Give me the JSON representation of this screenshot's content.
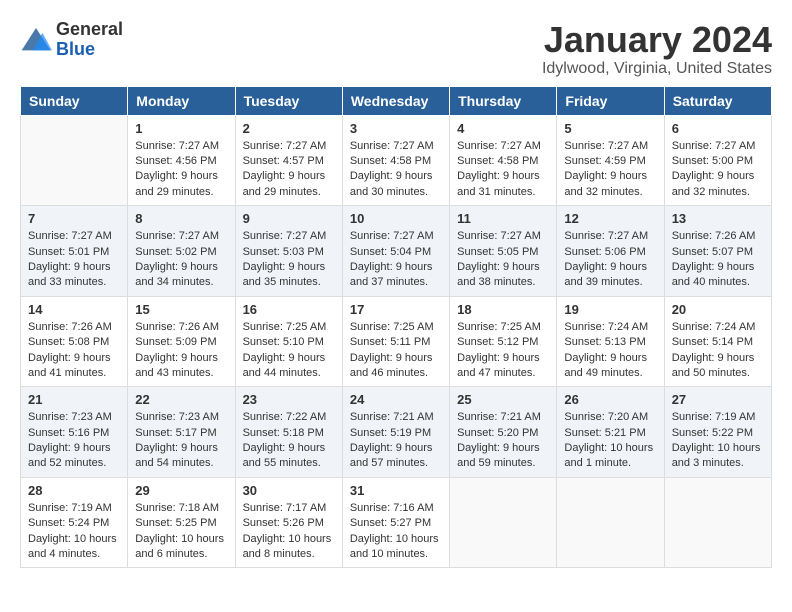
{
  "logo": {
    "general": "General",
    "blue": "Blue"
  },
  "header": {
    "title": "January 2024",
    "subtitle": "Idylwood, Virginia, United States"
  },
  "days_of_week": [
    "Sunday",
    "Monday",
    "Tuesday",
    "Wednesday",
    "Thursday",
    "Friday",
    "Saturday"
  ],
  "weeks": [
    [
      {
        "day": "",
        "content": ""
      },
      {
        "day": "1",
        "content": "Sunrise: 7:27 AM\nSunset: 4:56 PM\nDaylight: 9 hours\nand 29 minutes."
      },
      {
        "day": "2",
        "content": "Sunrise: 7:27 AM\nSunset: 4:57 PM\nDaylight: 9 hours\nand 29 minutes."
      },
      {
        "day": "3",
        "content": "Sunrise: 7:27 AM\nSunset: 4:58 PM\nDaylight: 9 hours\nand 30 minutes."
      },
      {
        "day": "4",
        "content": "Sunrise: 7:27 AM\nSunset: 4:58 PM\nDaylight: 9 hours\nand 31 minutes."
      },
      {
        "day": "5",
        "content": "Sunrise: 7:27 AM\nSunset: 4:59 PM\nDaylight: 9 hours\nand 32 minutes."
      },
      {
        "day": "6",
        "content": "Sunrise: 7:27 AM\nSunset: 5:00 PM\nDaylight: 9 hours\nand 32 minutes."
      }
    ],
    [
      {
        "day": "7",
        "content": "Sunrise: 7:27 AM\nSunset: 5:01 PM\nDaylight: 9 hours\nand 33 minutes."
      },
      {
        "day": "8",
        "content": "Sunrise: 7:27 AM\nSunset: 5:02 PM\nDaylight: 9 hours\nand 34 minutes."
      },
      {
        "day": "9",
        "content": "Sunrise: 7:27 AM\nSunset: 5:03 PM\nDaylight: 9 hours\nand 35 minutes."
      },
      {
        "day": "10",
        "content": "Sunrise: 7:27 AM\nSunset: 5:04 PM\nDaylight: 9 hours\nand 37 minutes."
      },
      {
        "day": "11",
        "content": "Sunrise: 7:27 AM\nSunset: 5:05 PM\nDaylight: 9 hours\nand 38 minutes."
      },
      {
        "day": "12",
        "content": "Sunrise: 7:27 AM\nSunset: 5:06 PM\nDaylight: 9 hours\nand 39 minutes."
      },
      {
        "day": "13",
        "content": "Sunrise: 7:26 AM\nSunset: 5:07 PM\nDaylight: 9 hours\nand 40 minutes."
      }
    ],
    [
      {
        "day": "14",
        "content": "Sunrise: 7:26 AM\nSunset: 5:08 PM\nDaylight: 9 hours\nand 41 minutes."
      },
      {
        "day": "15",
        "content": "Sunrise: 7:26 AM\nSunset: 5:09 PM\nDaylight: 9 hours\nand 43 minutes."
      },
      {
        "day": "16",
        "content": "Sunrise: 7:25 AM\nSunset: 5:10 PM\nDaylight: 9 hours\nand 44 minutes."
      },
      {
        "day": "17",
        "content": "Sunrise: 7:25 AM\nSunset: 5:11 PM\nDaylight: 9 hours\nand 46 minutes."
      },
      {
        "day": "18",
        "content": "Sunrise: 7:25 AM\nSunset: 5:12 PM\nDaylight: 9 hours\nand 47 minutes."
      },
      {
        "day": "19",
        "content": "Sunrise: 7:24 AM\nSunset: 5:13 PM\nDaylight: 9 hours\nand 49 minutes."
      },
      {
        "day": "20",
        "content": "Sunrise: 7:24 AM\nSunset: 5:14 PM\nDaylight: 9 hours\nand 50 minutes."
      }
    ],
    [
      {
        "day": "21",
        "content": "Sunrise: 7:23 AM\nSunset: 5:16 PM\nDaylight: 9 hours\nand 52 minutes."
      },
      {
        "day": "22",
        "content": "Sunrise: 7:23 AM\nSunset: 5:17 PM\nDaylight: 9 hours\nand 54 minutes."
      },
      {
        "day": "23",
        "content": "Sunrise: 7:22 AM\nSunset: 5:18 PM\nDaylight: 9 hours\nand 55 minutes."
      },
      {
        "day": "24",
        "content": "Sunrise: 7:21 AM\nSunset: 5:19 PM\nDaylight: 9 hours\nand 57 minutes."
      },
      {
        "day": "25",
        "content": "Sunrise: 7:21 AM\nSunset: 5:20 PM\nDaylight: 9 hours\nand 59 minutes."
      },
      {
        "day": "26",
        "content": "Sunrise: 7:20 AM\nSunset: 5:21 PM\nDaylight: 10 hours\nand 1 minute."
      },
      {
        "day": "27",
        "content": "Sunrise: 7:19 AM\nSunset: 5:22 PM\nDaylight: 10 hours\nand 3 minutes."
      }
    ],
    [
      {
        "day": "28",
        "content": "Sunrise: 7:19 AM\nSunset: 5:24 PM\nDaylight: 10 hours\nand 4 minutes."
      },
      {
        "day": "29",
        "content": "Sunrise: 7:18 AM\nSunset: 5:25 PM\nDaylight: 10 hours\nand 6 minutes."
      },
      {
        "day": "30",
        "content": "Sunrise: 7:17 AM\nSunset: 5:26 PM\nDaylight: 10 hours\nand 8 minutes."
      },
      {
        "day": "31",
        "content": "Sunrise: 7:16 AM\nSunset: 5:27 PM\nDaylight: 10 hours\nand 10 minutes."
      },
      {
        "day": "",
        "content": ""
      },
      {
        "day": "",
        "content": ""
      },
      {
        "day": "",
        "content": ""
      }
    ]
  ]
}
